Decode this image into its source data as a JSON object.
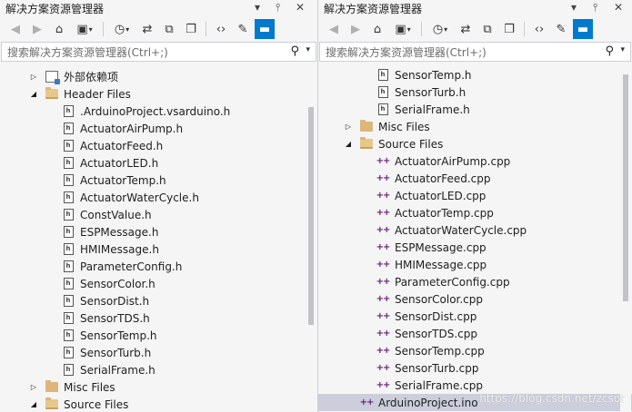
{
  "left": {
    "title": "解决方案资源管理器",
    "search_placeholder": "搜索解决方案资源管理器(Ctrl+;)",
    "tree": [
      {
        "label": "外部依赖项",
        "type": "ext",
        "expander": "▷",
        "indent": 0
      },
      {
        "label": "Header Files",
        "type": "folder-open",
        "expander": "◢",
        "indent": 0
      },
      {
        "label": ".ArduinoProject.vsarduino.h",
        "type": "h",
        "indent": 1
      },
      {
        "label": "ActuatorAirPump.h",
        "type": "h",
        "indent": 1
      },
      {
        "label": "ActuatorFeed.h",
        "type": "h",
        "indent": 1
      },
      {
        "label": "ActuatorLED.h",
        "type": "h",
        "indent": 1
      },
      {
        "label": "ActuatorTemp.h",
        "type": "h",
        "indent": 1
      },
      {
        "label": "ActuatorWaterCycle.h",
        "type": "h",
        "indent": 1
      },
      {
        "label": "ConstValue.h",
        "type": "h",
        "indent": 1
      },
      {
        "label": "ESPMessage.h",
        "type": "h",
        "indent": 1
      },
      {
        "label": "HMIMessage.h",
        "type": "h",
        "indent": 1
      },
      {
        "label": "ParameterConfig.h",
        "type": "h",
        "indent": 1
      },
      {
        "label": "SensorColor.h",
        "type": "h",
        "indent": 1
      },
      {
        "label": "SensorDist.h",
        "type": "h",
        "indent": 1
      },
      {
        "label": "SensorTDS.h",
        "type": "h",
        "indent": 1
      },
      {
        "label": "SensorTemp.h",
        "type": "h",
        "indent": 1
      },
      {
        "label": "SensorTurb.h",
        "type": "h",
        "indent": 1
      },
      {
        "label": "SerialFrame.h",
        "type": "h",
        "indent": 1
      },
      {
        "label": "Misc Files",
        "type": "folder",
        "expander": "▷",
        "indent": 0
      },
      {
        "label": "Source Files",
        "type": "folder-open",
        "expander": "◢",
        "indent": 0
      }
    ]
  },
  "right": {
    "title": "解决方案资源管理器",
    "search_placeholder": "搜索解决方案资源管理器(Ctrl+;)",
    "tree": [
      {
        "label": "SensorTemp.h",
        "type": "h",
        "indent": 1
      },
      {
        "label": "SensorTurb.h",
        "type": "h",
        "indent": 1
      },
      {
        "label": "SerialFrame.h",
        "type": "h",
        "indent": 1
      },
      {
        "label": "Misc Files",
        "type": "folder",
        "expander": "▷",
        "indent": 0
      },
      {
        "label": "Source Files",
        "type": "folder-open",
        "expander": "◢",
        "indent": 0
      },
      {
        "label": "ActuatorAirPump.cpp",
        "type": "cpp",
        "indent": 1
      },
      {
        "label": "ActuatorFeed.cpp",
        "type": "cpp",
        "indent": 1
      },
      {
        "label": "ActuatorLED.cpp",
        "type": "cpp",
        "indent": 1
      },
      {
        "label": "ActuatorTemp.cpp",
        "type": "cpp",
        "indent": 1
      },
      {
        "label": "ActuatorWaterCycle.cpp",
        "type": "cpp",
        "indent": 1
      },
      {
        "label": "ESPMessage.cpp",
        "type": "cpp",
        "indent": 1
      },
      {
        "label": "HMIMessage.cpp",
        "type": "cpp",
        "indent": 1
      },
      {
        "label": "ParameterConfig.cpp",
        "type": "cpp",
        "indent": 1
      },
      {
        "label": "SensorColor.cpp",
        "type": "cpp",
        "indent": 1
      },
      {
        "label": "SensorDist.cpp",
        "type": "cpp",
        "indent": 1
      },
      {
        "label": "SensorTDS.cpp",
        "type": "cpp",
        "indent": 1
      },
      {
        "label": "SensorTemp.cpp",
        "type": "cpp",
        "indent": 1
      },
      {
        "label": "SensorTurb.cpp",
        "type": "cpp",
        "indent": 1
      },
      {
        "label": "SerialFrame.cpp",
        "type": "cpp",
        "indent": 1
      },
      {
        "label": "ArduinoProject.ino",
        "type": "ino",
        "indent": 0,
        "selected": true
      }
    ]
  },
  "watermark": "https://blog.csdn.net/zcsor",
  "icons": {
    "back": "←",
    "forward": "→",
    "home": "⌂",
    "sync": "⇆",
    "history": "◷",
    "collapse": "⊟",
    "copy": "❐",
    "code": "‹›",
    "wrench": "🔧",
    "pin": "⊥",
    "close": "✕",
    "dropdown": "▾",
    "search": "⚲"
  },
  "colors": {
    "accent": "#007acc",
    "folder": "#dcb67a",
    "cpp": "#68217a",
    "selected_row": "#cccedb"
  }
}
